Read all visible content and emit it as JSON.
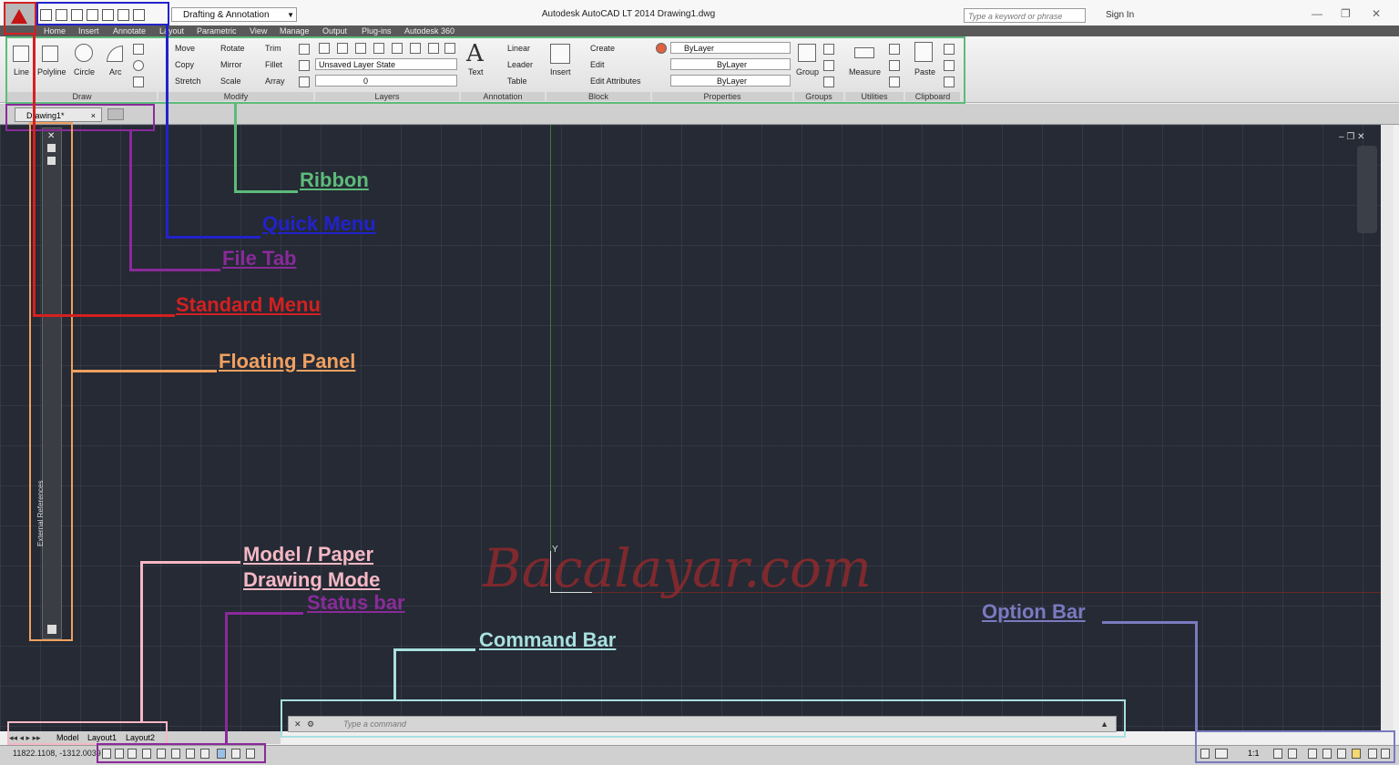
{
  "title_bar": {
    "workspace": "Drafting & Annotation",
    "title": "Autodesk AutoCAD LT 2014    Drawing1.dwg",
    "search_placeholder": "Type a keyword or phrase",
    "sign_in": "Sign In",
    "app_label": "LT"
  },
  "menu_tabs": [
    "Home",
    "Insert",
    "Annotate",
    "Layout",
    "Parametric",
    "View",
    "Manage",
    "Output",
    "Plug-ins",
    "Autodesk 360"
  ],
  "ribbon": {
    "draw": {
      "title": "Draw",
      "tools": [
        "Line",
        "Polyline",
        "Circle",
        "Arc"
      ]
    },
    "modify": {
      "title": "Modify",
      "tools": [
        "Move",
        "Rotate",
        "Trim",
        "Copy",
        "Mirror",
        "Fillet",
        "Stretch",
        "Scale",
        "Array"
      ]
    },
    "layers": {
      "title": "Layers",
      "layer_state": "Unsaved Layer State",
      "current_layer": "0"
    },
    "annotation": {
      "title": "Annotation",
      "text": "Text",
      "tools": [
        "Linear",
        "Leader",
        "Table"
      ]
    },
    "block": {
      "title": "Block",
      "insert": "Insert",
      "tools": [
        "Create",
        "Edit",
        "Edit Attributes"
      ]
    },
    "properties": {
      "title": "Properties",
      "values": [
        "ByLayer",
        "ByLayer",
        "ByLayer"
      ]
    },
    "groups": {
      "title": "Groups",
      "group": "Group"
    },
    "utilities": {
      "title": "Utilities",
      "measure": "Measure"
    },
    "clipboard": {
      "title": "Clipboard",
      "paste": "Paste"
    }
  },
  "file_tab": "Drawing1*",
  "floating_panel_label": "External References",
  "watermark": "Bacalayar.com",
  "command_placeholder": "Type a command",
  "layout_tabs": [
    "Model",
    "Layout1",
    "Layout2"
  ],
  "coordinates": "11822.1108, -1312.0039",
  "option_bar_scale": "1:1",
  "annotations": {
    "ribbon": "Ribbon",
    "quick_menu": "Quick Menu",
    "file_tab": "File Tab",
    "standard_menu": "Standard Menu",
    "floating_panel": "Floating Panel",
    "model_paper_1": "Model / Paper",
    "model_paper_2": "Drawing Mode",
    "status_bar": "Status bar",
    "command_bar": "Command Bar",
    "option_bar": "Option Bar"
  },
  "colors": {
    "ribbon": "#5dbb7a",
    "quick_menu": "#2222cc",
    "file_tab": "#8a2a9a",
    "standard_menu": "#d42020",
    "floating_panel": "#f0a060",
    "model_paper": "#f4b8c4",
    "status_bar": "#8a2a9a",
    "command_bar": "#a8e0e0",
    "option_bar": "#7a7ac0"
  }
}
